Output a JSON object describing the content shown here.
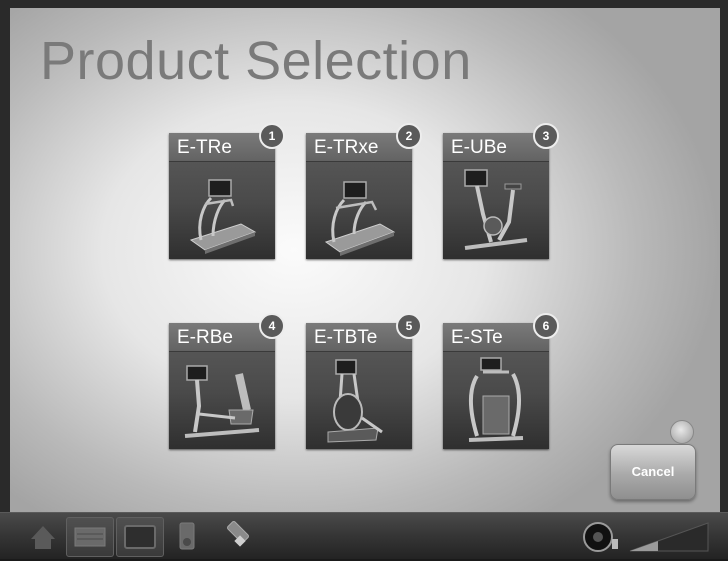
{
  "page": {
    "title": "Product Selection"
  },
  "products": [
    {
      "label": "E-TRe",
      "number": "1",
      "icon": "treadmill-icon"
    },
    {
      "label": "E-TRxe",
      "number": "2",
      "icon": "treadmill-icon"
    },
    {
      "label": "E-UBe",
      "number": "3",
      "icon": "upright-bike-icon"
    },
    {
      "label": "E-RBe",
      "number": "4",
      "icon": "recumbent-bike-icon"
    },
    {
      "label": "E-TBTe",
      "number": "5",
      "icon": "elliptical-icon"
    },
    {
      "label": "E-STe",
      "number": "6",
      "icon": "stepper-icon"
    }
  ],
  "cancel": {
    "label": "Cancel"
  },
  "taskbar": {
    "icons": [
      "home-icon",
      "keyboard-icon",
      "monitor-icon",
      "ipod-icon",
      "usb-drive-icon",
      "speaker-icon",
      "volume-level-icon"
    ]
  }
}
